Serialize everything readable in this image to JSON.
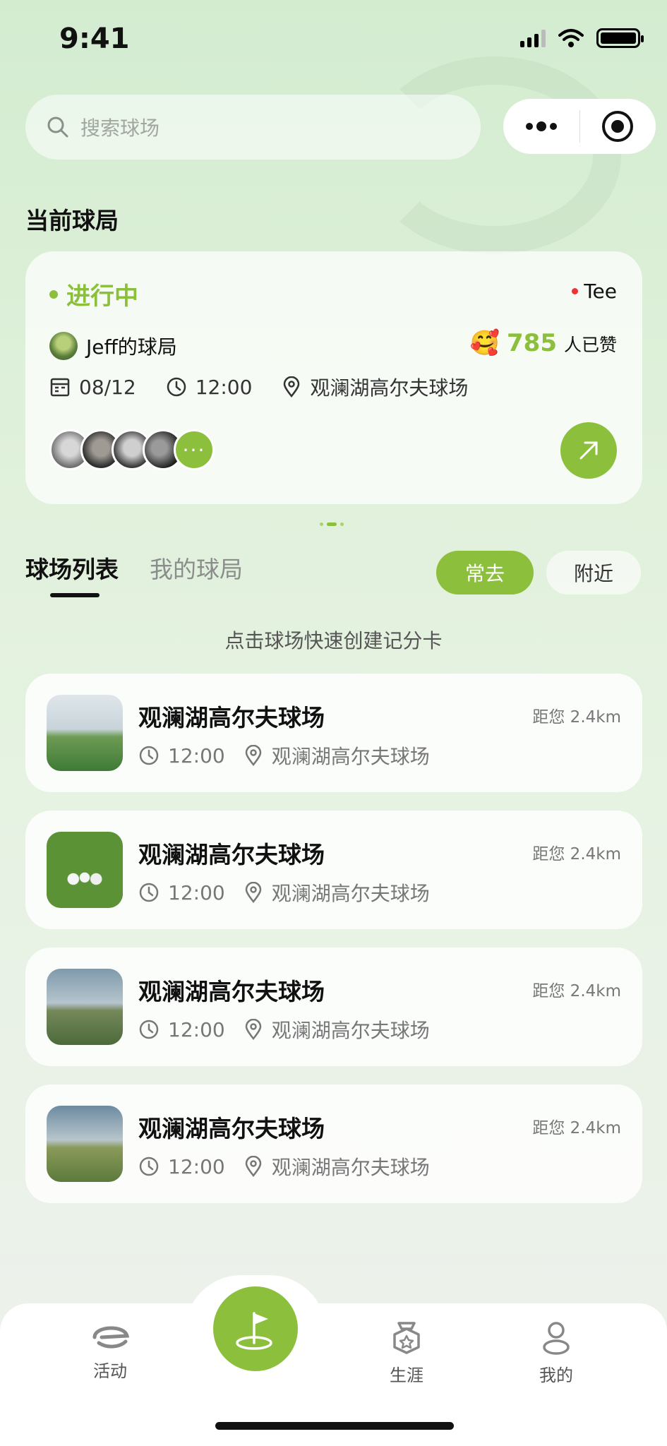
{
  "status_bar": {
    "time": "9:41"
  },
  "search": {
    "placeholder": "搜索球场"
  },
  "current_section": {
    "title": "当前球局",
    "card": {
      "status": "进行中",
      "tee": "Tee",
      "owner": "Jeff的球局",
      "likes_count": "785",
      "likes_label": "人已赞",
      "date": "08/12",
      "time": "12:00",
      "location": "观澜湖高尔夫球场",
      "more_label": "···"
    }
  },
  "tabs": {
    "course_list": "球场列表",
    "my_games": "我的球局"
  },
  "filters": {
    "frequent": "常去",
    "nearby": "附近"
  },
  "hint": "点击球场快速创建记分卡",
  "courses": [
    {
      "name": "观澜湖高尔夫球场",
      "distance": "距您 2.4km",
      "time": "12:00",
      "location": "观澜湖高尔夫球场"
    },
    {
      "name": "观澜湖高尔夫球场",
      "distance": "距您 2.4km",
      "time": "12:00",
      "location": "观澜湖高尔夫球场"
    },
    {
      "name": "观澜湖高尔夫球场",
      "distance": "距您 2.4km",
      "time": "12:00",
      "location": "观澜湖高尔夫球场"
    },
    {
      "name": "观澜湖高尔夫球场",
      "distance": "距您 2.4km",
      "time": "12:00",
      "location": "观澜湖高尔夫球场"
    }
  ],
  "bottom_nav": {
    "activity": "活动",
    "career": "生涯",
    "mine": "我的"
  },
  "colors": {
    "accent": "#8cc03c",
    "live_dot": "#e33333"
  },
  "icons": [
    "search-icon",
    "more-dots-icon",
    "target-icon",
    "calendar-icon",
    "clock-icon",
    "location-pin-icon",
    "arrow-up-right-icon",
    "golf-flag-icon",
    "medal-icon",
    "user-icon"
  ]
}
